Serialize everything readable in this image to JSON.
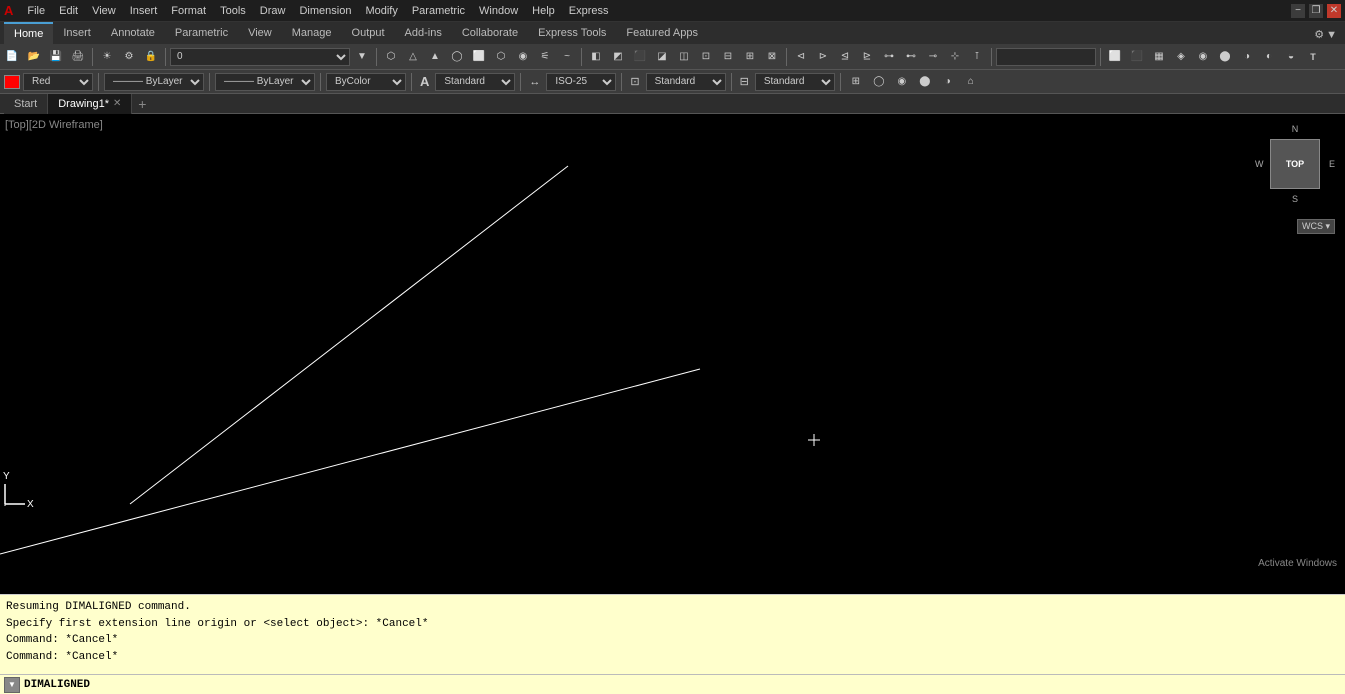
{
  "titlebar": {
    "icon": "A",
    "menu_items": [
      "File",
      "Edit",
      "View",
      "Insert",
      "Format",
      "Tools",
      "Draw",
      "Dimension",
      "Modify",
      "Parametric",
      "Window",
      "Help",
      "Express"
    ],
    "window_controls": {
      "minimize": "−",
      "restore": "❐",
      "close": "✕"
    }
  },
  "ribbon": {
    "tabs": [
      "Home",
      "Insert",
      "Annotate",
      "Parametric",
      "View",
      "Manage",
      "Output",
      "Add-ins",
      "Collaborate",
      "Express Tools",
      "Featured Apps"
    ],
    "active_tab": "Home",
    "workspace_label": "▼"
  },
  "toolbar1": {
    "layer_input": "0",
    "search_placeholder": ""
  },
  "props_bar": {
    "color_label": "Red",
    "linetype_label": "ByLayer",
    "lineweight_label": "ByLayer",
    "transparency_label": "ByColor",
    "annotation_label": "A",
    "style_label": "Standard",
    "scale_label": "ISO-25",
    "dim_style_label": "Standard",
    "table_label": "Standard"
  },
  "viewport": {
    "label": "[Top][2D Wireframe]"
  },
  "viewcube": {
    "north": "N",
    "south": "S",
    "east": "E",
    "west": "W",
    "top_label": "TOP",
    "wcs_label": "WCS ▾"
  },
  "tabs": {
    "start_label": "Start",
    "drawing_label": "Drawing1*",
    "add_label": "+"
  },
  "command": {
    "line1": "Resuming DIMALIGNED command.",
    "line2": "Specify first extension line origin or <select object>: *Cancel*",
    "line3": "Command: *Cancel*",
    "line4": "Command: *Cancel*",
    "input_label": "DIMALIGNED"
  },
  "activate_windows_text": "Activate Windows"
}
